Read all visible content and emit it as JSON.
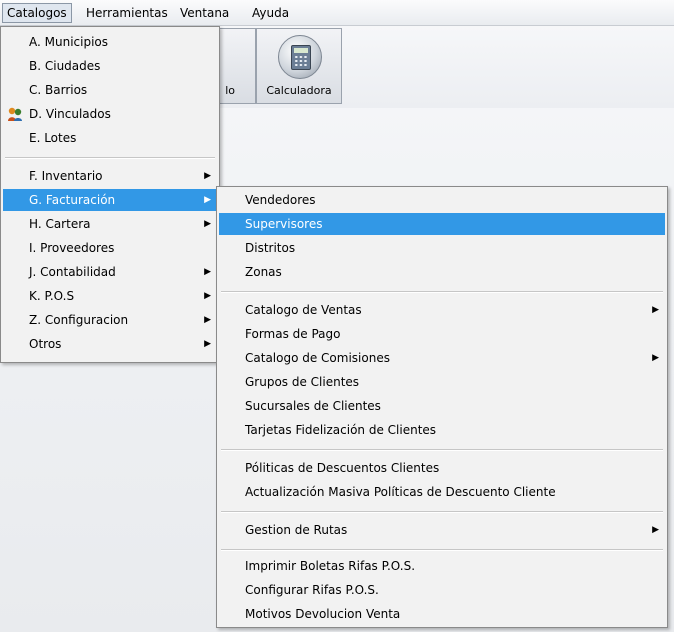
{
  "menubar": {
    "items": [
      {
        "label": "Catalogos"
      },
      {
        "label": "Herramientas"
      },
      {
        "label": "Ventana"
      },
      {
        "label": "Ayuda"
      }
    ]
  },
  "toolbar": {
    "partial_label": "lo",
    "calculator_label": "Calculadora"
  },
  "catalogos_menu": {
    "items": [
      {
        "label": "A. Municipios"
      },
      {
        "label": "B. Ciudades"
      },
      {
        "label": "C. Barrios"
      },
      {
        "label": "D. Vinculados",
        "icon": "vinculados-icon"
      },
      {
        "label": "E. Lotes"
      },
      {
        "label": "F. Inventario"
      },
      {
        "label": "G. Facturación"
      },
      {
        "label": "H. Cartera"
      },
      {
        "label": "I. Proveedores"
      },
      {
        "label": "J. Contabilidad"
      },
      {
        "label": "K. P.O.S"
      },
      {
        "label": "Z. Configuracion"
      },
      {
        "label": "Otros"
      }
    ]
  },
  "facturacion_menu": {
    "items": [
      {
        "label": "Vendedores"
      },
      {
        "label": "Supervisores"
      },
      {
        "label": "Distritos"
      },
      {
        "label": "Zonas"
      },
      {
        "label": "Catalogo de Ventas"
      },
      {
        "label": "Formas de Pago"
      },
      {
        "label": "Catalogo de Comisiones"
      },
      {
        "label": "Grupos de Clientes"
      },
      {
        "label": "Sucursales de Clientes"
      },
      {
        "label": "Tarjetas Fidelización de Clientes"
      },
      {
        "label": "Póliticas de Descuentos Clientes"
      },
      {
        "label": "Actualización Masiva Políticas de Descuento Cliente"
      },
      {
        "label": "Gestion de  Rutas"
      },
      {
        "label": "Imprimir Boletas Rifas P.O.S."
      },
      {
        "label": "Configurar Rifas  P.O.S."
      },
      {
        "label": "Motivos Devolucion Venta"
      }
    ]
  },
  "colors": {
    "highlight": "#3298e6",
    "menu_bg": "#f2f2f2"
  }
}
